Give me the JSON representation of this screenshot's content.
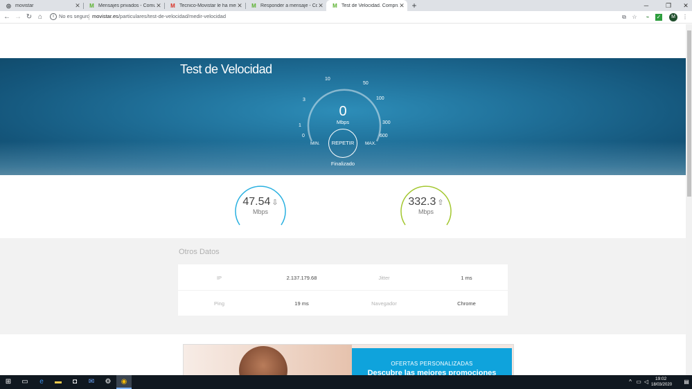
{
  "browser": {
    "tabs": [
      {
        "title": "movistar",
        "icon": "globe-icon"
      },
      {
        "title": "Mensajes privados - Comunidad",
        "icon": "movistar-m-icon"
      },
      {
        "title": "Tecnico-Movistar le ha mencion",
        "icon": "gmail-icon"
      },
      {
        "title": "Responder a mensaje - Comunid",
        "icon": "movistar-m-icon"
      },
      {
        "title": "Test de Velocidad. Comprueba la",
        "icon": "movistar-m-icon",
        "active": true
      }
    ],
    "address": {
      "security_label": "No es seguro",
      "domain": "movistar.es",
      "path": "/particulares/test-de-velocidad/medir-velocidad"
    },
    "profile_initial": "M"
  },
  "hero": {
    "title": "Test de Velocidad",
    "gauge": {
      "ticks": [
        "0",
        "1",
        "3",
        "10",
        "50",
        "100",
        "300",
        "600"
      ],
      "value": "0",
      "unit": "Mbps",
      "min_label": "MIN.",
      "max_label": "MAX."
    },
    "repeat_label": "REPETIR",
    "status": "Finalizado"
  },
  "results": {
    "download": {
      "value": "47.54",
      "unit": "Mbps",
      "arrow": "⇩"
    },
    "upload": {
      "value": "332.3",
      "unit": "Mbps",
      "arrow": "⇧"
    }
  },
  "otros_datos": {
    "title": "Otros Datos",
    "ip_label": "IP",
    "ip_value": "2.137.179.68",
    "jitter_label": "Jitter",
    "jitter_value": "1 ms",
    "ping_label": "Ping",
    "ping_value": "19 ms",
    "navegador_label": "Navegador",
    "navegador_value": "Chrome"
  },
  "banner": {
    "kicker": "OFERTAS PERSONALIZADAS",
    "headline": "Descubre las mejores promociones"
  },
  "taskbar": {
    "time": "19:02",
    "date": "18/03/2020"
  },
  "colors": {
    "download_ring": "#29b0e0",
    "upload_ring": "#a3c72f",
    "banner_blue": "#0fa3dc",
    "hero_blue": "#1f6f98"
  }
}
